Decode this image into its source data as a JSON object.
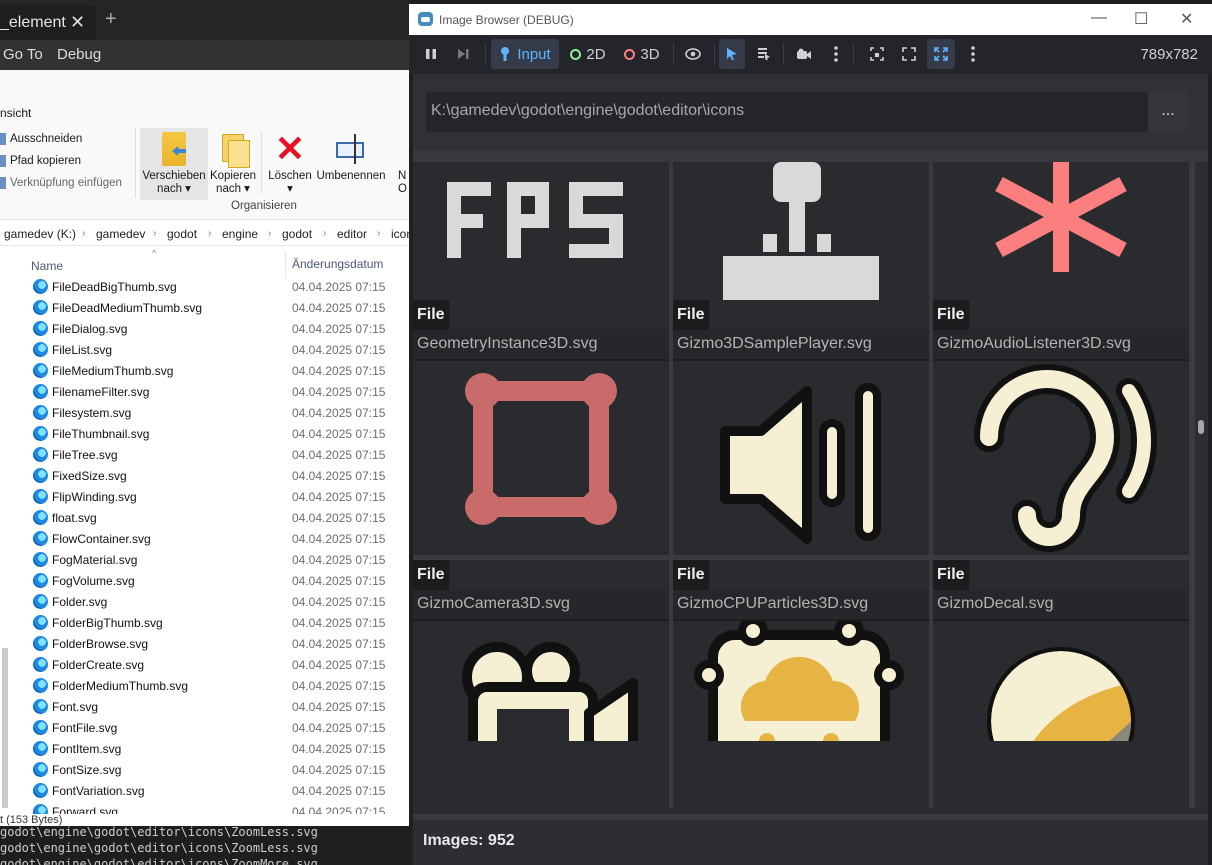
{
  "editor": {
    "tab_label": "_element",
    "tab_close": "✕",
    "new_tab": "+",
    "menu": [
      "Go To",
      "Debug"
    ],
    "terminal_lines": [
      "godot\\engine\\godot\\editor\\icons\\ZoomLess.svg",
      "godot\\engine\\godot\\editor\\icons\\ZoomLess.svg",
      "godot\\engine\\godot\\editor\\icons\\ZoomMore.svg"
    ]
  },
  "explorer": {
    "ribbon_tab": "nsicht",
    "clipboard": [
      "Ausschneiden",
      "Pfad kopieren",
      "Verknüpfung einfügen"
    ],
    "buttons": {
      "move": [
        "Verschieben",
        "nach ▾"
      ],
      "copy": [
        "Kopieren",
        "nach ▾"
      ],
      "delete": [
        "Löschen",
        "▾"
      ],
      "rename": [
        "Umbenennen"
      ],
      "cut_label": "N",
      "cut_label2": "O"
    },
    "group_label": "Organisieren",
    "breadcrumb": [
      "gamedev (K:)",
      "gamedev",
      "godot",
      "engine",
      "godot",
      "editor",
      "icon"
    ],
    "columns": {
      "name": "Name",
      "date": "Änderungsdatum"
    },
    "files": [
      {
        "name": "FileDeadBigThumb.svg",
        "date": "04.04.2025 07:15"
      },
      {
        "name": "FileDeadMediumThumb.svg",
        "date": "04.04.2025 07:15"
      },
      {
        "name": "FileDialog.svg",
        "date": "04.04.2025 07:15"
      },
      {
        "name": "FileList.svg",
        "date": "04.04.2025 07:15"
      },
      {
        "name": "FileMediumThumb.svg",
        "date": "04.04.2025 07:15"
      },
      {
        "name": "FilenameFilter.svg",
        "date": "04.04.2025 07:15"
      },
      {
        "name": "Filesystem.svg",
        "date": "04.04.2025 07:15"
      },
      {
        "name": "FileThumbnail.svg",
        "date": "04.04.2025 07:15"
      },
      {
        "name": "FileTree.svg",
        "date": "04.04.2025 07:15"
      },
      {
        "name": "FixedSize.svg",
        "date": "04.04.2025 07:15"
      },
      {
        "name": "FlipWinding.svg",
        "date": "04.04.2025 07:15"
      },
      {
        "name": "float.svg",
        "date": "04.04.2025 07:15"
      },
      {
        "name": "FlowContainer.svg",
        "date": "04.04.2025 07:15"
      },
      {
        "name": "FogMaterial.svg",
        "date": "04.04.2025 07:15"
      },
      {
        "name": "FogVolume.svg",
        "date": "04.04.2025 07:15"
      },
      {
        "name": "Folder.svg",
        "date": "04.04.2025 07:15"
      },
      {
        "name": "FolderBigThumb.svg",
        "date": "04.04.2025 07:15"
      },
      {
        "name": "FolderBrowse.svg",
        "date": "04.04.2025 07:15"
      },
      {
        "name": "FolderCreate.svg",
        "date": "04.04.2025 07:15"
      },
      {
        "name": "FolderMediumThumb.svg",
        "date": "04.04.2025 07:15"
      },
      {
        "name": "Font.svg",
        "date": "04.04.2025 07:15"
      },
      {
        "name": "FontFile.svg",
        "date": "04.04.2025 07:15"
      },
      {
        "name": "FontItem.svg",
        "date": "04.04.2025 07:15"
      },
      {
        "name": "FontSize.svg",
        "date": "04.04.2025 07:15"
      },
      {
        "name": "FontVariation.svg",
        "date": "04.04.2025 07:15"
      },
      {
        "name": "Forward.svg",
        "date": "04.04.2025 07:15"
      }
    ],
    "status": "t (153 Bytes)"
  },
  "godot": {
    "title": "Image Browser (DEBUG)",
    "window_controls": [
      "—",
      "☐",
      "✕"
    ],
    "toolbar": {
      "input": "Input",
      "mode_2d": "2D",
      "mode_3d": "3D",
      "resolution": "789x782"
    },
    "path": "K:\\gamedev\\godot\\engine\\godot\\editor\\icons",
    "browse_button": "...",
    "tiles": [
      {
        "kind": "",
        "name": "",
        "icon": "fps-icon"
      },
      {
        "kind": "",
        "name": "",
        "icon": "joystick-icon"
      },
      {
        "kind": "",
        "name": "",
        "icon": "asterisk-icon"
      },
      {
        "kind": "File",
        "name": "GeometryInstance3D.svg",
        "icon": "geometry-instance-icon"
      },
      {
        "kind": "File",
        "name": "Gizmo3DSamplePlayer.svg",
        "icon": "speaker-icon"
      },
      {
        "kind": "File",
        "name": "GizmoAudioListener3D.svg",
        "icon": "ear-icon"
      },
      {
        "kind": "File",
        "name": "GizmoCamera3D.svg",
        "icon": "camera-icon"
      },
      {
        "kind": "File",
        "name": "GizmoCPUParticles3D.svg",
        "icon": "particles-icon"
      },
      {
        "kind": "File",
        "name": "GizmoDecal.svg",
        "icon": "decal-icon"
      }
    ],
    "status": "Images: 952"
  },
  "colors": {
    "godot_bg": "#37393f",
    "tile_bg": "#2a2b2e",
    "icon_cream": "#f5f0d4",
    "icon_gold": "#e5b443",
    "icon_red": "#fc7f7f",
    "accent_blue": "#5fb3ff"
  }
}
